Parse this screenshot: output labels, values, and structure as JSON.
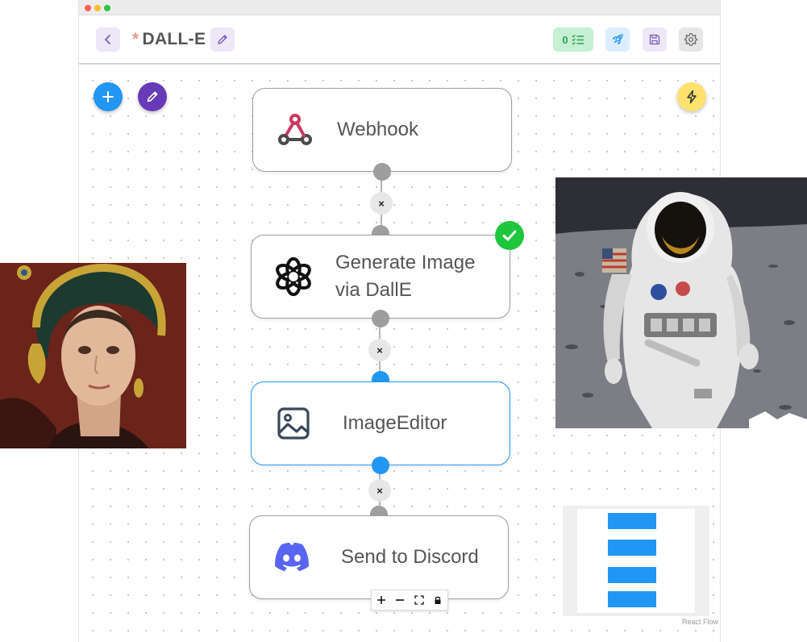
{
  "app": {
    "title": "DALL-E",
    "unsaved_marker": "*",
    "tasks_count": "0",
    "attribution": "React Flow"
  },
  "colors": {
    "accent_blue": "#2196f3",
    "accent_purple": "#673ab7",
    "success_green": "#1ec63c",
    "flash_yellow": "#ffe26e",
    "discord": "#5865f2"
  },
  "icons": {
    "back": "chevron-left-icon",
    "edit_title": "pencil-icon",
    "tasks": "checklist-icon",
    "deploy": "rocket-icon",
    "save": "floppy-disk-icon",
    "settings": "gear-icon",
    "add": "plus-icon",
    "edit": "pencil-icon",
    "flash": "lightning-icon"
  },
  "nodes": [
    {
      "label": "Webhook",
      "icon": "webhook-icon"
    },
    {
      "label": "Generate Image via DallE",
      "icon": "openai-icon",
      "status": "success"
    },
    {
      "label": "ImageEditor",
      "icon": "image-icon",
      "selected": true
    },
    {
      "label": "Send to Discord",
      "icon": "discord-icon"
    }
  ],
  "edges": [
    {
      "delete_label": "×"
    },
    {
      "delete_label": "×"
    },
    {
      "delete_label": "×"
    }
  ],
  "controls": [
    "zoom-in",
    "zoom-out",
    "fit-view",
    "lock"
  ]
}
